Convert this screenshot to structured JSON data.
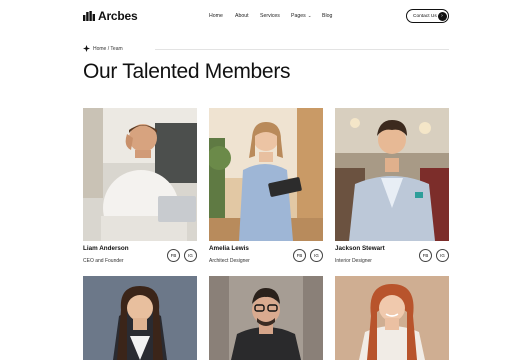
{
  "brand": {
    "name": "Arcbes"
  },
  "nav": {
    "items": [
      "Home",
      "About",
      "Services",
      "Pages",
      "Blog"
    ],
    "contact_label": "Contact Us"
  },
  "breadcrumb": {
    "text": "Home / Team"
  },
  "page": {
    "title": "Our Talented Members"
  },
  "members": [
    {
      "name": "Liam Anderson",
      "role": "CEO and Founder",
      "fb": "FB",
      "ig": "IG"
    },
    {
      "name": "Amelia Lewis",
      "role": "Architect Designer",
      "fb": "FB",
      "ig": "IG"
    },
    {
      "name": "Jackson Stewart",
      "role": "Interior Designer",
      "fb": "FB",
      "ig": "IG"
    }
  ],
  "colors": {
    "accent": "#111111",
    "divider": "#e3e3e3",
    "background": "#ffffff"
  },
  "icons": {
    "logo": "building-bars-icon",
    "breadcrumb": "diamond-cross-icon",
    "contact": "arrow-right-icon",
    "dropdown": "chevron-down-icon"
  }
}
